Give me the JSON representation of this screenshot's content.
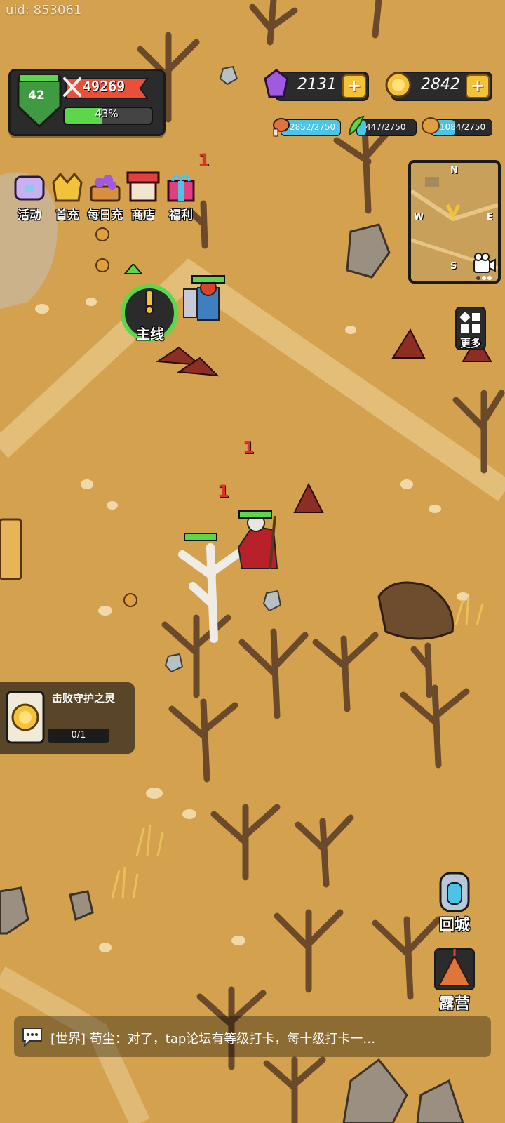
{
  "uid": "uid: 853061",
  "player": {
    "level": "42",
    "power": "49269",
    "exp_percent": "43%",
    "exp_fraction": 0.43
  },
  "currencies": {
    "gems": "2131",
    "gold": "2842"
  },
  "resources": [
    {
      "name": "meat",
      "text": "2852/2750",
      "fill": 1.0,
      "color": "#4cc4e8"
    },
    {
      "name": "herb",
      "text": "447/2750",
      "fill": 0.16,
      "color": "#4cc4e8"
    },
    {
      "name": "wood",
      "text": "1084/2750",
      "fill": 0.39,
      "color": "#4cc4e8"
    }
  ],
  "menu": [
    "活动",
    "首充",
    "每日充",
    "商店",
    "福利"
  ],
  "quest_main_label": "主线",
  "more_label": "更多",
  "minimap": {
    "n": "N",
    "w": "W",
    "e": "E",
    "s": "S"
  },
  "return_city_label": "回城",
  "camp_label": "露营",
  "quest": {
    "title": "击败守护之灵",
    "progress": "0/1"
  },
  "chat": "[世界] 苟尘：对了，tap论坛有等级打卡，每十级打卡一…",
  "damage_numbers": [
    "1",
    "1",
    "1"
  ]
}
